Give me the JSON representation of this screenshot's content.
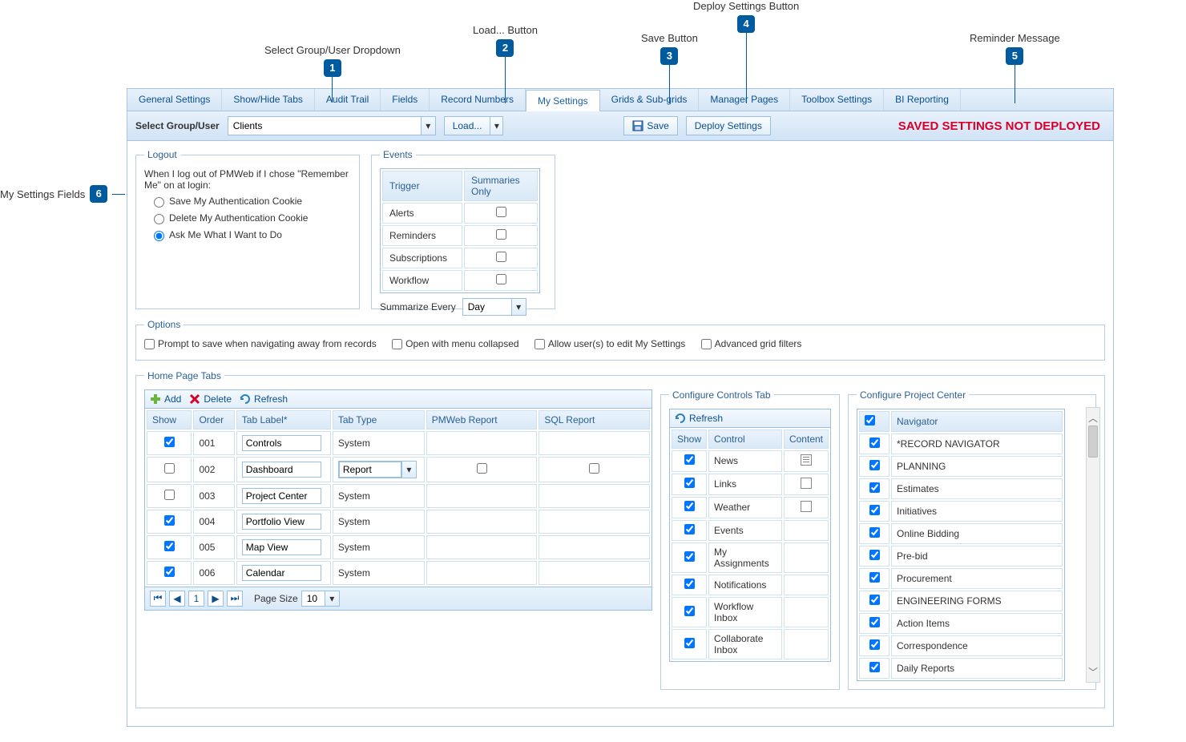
{
  "callouts": {
    "c1": "Select Group/User Dropdown",
    "c2": "Load... Button",
    "c3": "Save Button",
    "c4": "Deploy Settings Button",
    "c5": "Reminder Message",
    "c6": "My Settings Fields"
  },
  "tabs": {
    "t0": "General Settings",
    "t1": "Show/Hide Tabs",
    "t2": "Audit Trail",
    "t3": "Fields",
    "t4": "Record Numbers",
    "t5": "My Settings",
    "t6": "Grids & Sub-grids",
    "t7": "Manager Pages",
    "t8": "Toolbox Settings",
    "t9": "BI Reporting"
  },
  "toolbar": {
    "select_label": "Select Group/User",
    "select_value": "Clients",
    "load_label": "Load...",
    "save_label": "Save",
    "deploy_label": "Deploy Settings",
    "reminder": "SAVED SETTINGS NOT DEPLOYED"
  },
  "logout": {
    "legend": "Logout",
    "intro": "When I log out of PMWeb if I chose \"Remember Me\" on at login:",
    "opt1": "Save My Authentication Cookie",
    "opt2": "Delete My Authentication Cookie",
    "opt3": "Ask Me What I Want to Do"
  },
  "events": {
    "legend": "Events",
    "col_trigger": "Trigger",
    "col_summaries": "Summaries Only",
    "r1": "Alerts",
    "r2": "Reminders",
    "r3": "Subscriptions",
    "r4": "Workflow",
    "summarize_label": "Summarize Every",
    "summarize_value": "Day"
  },
  "options": {
    "legend": "Options",
    "o1": "Prompt to save when navigating away from records",
    "o2": "Open with menu collapsed",
    "o3": "Allow user(s) to edit My Settings",
    "o4": "Advanced grid filters"
  },
  "home": {
    "legend": "Home Page Tabs",
    "add": "Add",
    "delete": "Delete",
    "refresh": "Refresh",
    "cols": {
      "show": "Show",
      "order": "Order",
      "label": "Tab Label*",
      "type": "Tab Type",
      "pmweb": "PMWeb Report",
      "sql": "SQL Report"
    },
    "rows": [
      {
        "show": true,
        "order": "001",
        "label": "Controls",
        "type": "System"
      },
      {
        "show": false,
        "order": "002",
        "label": "Dashboard",
        "type": "Report",
        "type_dd": true,
        "pmweb_cb": true,
        "sql_cb": true
      },
      {
        "show": false,
        "order": "003",
        "label": "Project Center",
        "type": "System"
      },
      {
        "show": true,
        "order": "004",
        "label": "Portfolio View",
        "type": "System"
      },
      {
        "show": true,
        "order": "005",
        "label": "Map View",
        "type": "System"
      },
      {
        "show": true,
        "order": "006",
        "label": "Calendar",
        "type": "System"
      }
    ],
    "pager": {
      "page": "1",
      "pagesize_label": "Page Size",
      "pagesize": "10"
    }
  },
  "controls_tab": {
    "legend": "Configure Controls Tab",
    "refresh": "Refresh",
    "cols": {
      "show": "Show",
      "control": "Control",
      "content": "Content"
    },
    "rows": [
      {
        "label": "News",
        "icon": "list"
      },
      {
        "label": "Links",
        "icon": "box"
      },
      {
        "label": "Weather",
        "icon": "box"
      },
      {
        "label": "Events"
      },
      {
        "label": "My Assignments"
      },
      {
        "label": "Notifications"
      },
      {
        "label": "Workflow Inbox"
      },
      {
        "label": "Collaborate Inbox"
      }
    ]
  },
  "project_center": {
    "legend": "Configure Project Center",
    "col": "Navigator",
    "rows": [
      {
        "label": "*RECORD NAVIGATOR",
        "bold": true
      },
      {
        "label": "PLANNING",
        "bold": true
      },
      {
        "label": "Estimates"
      },
      {
        "label": "Initiatives"
      },
      {
        "label": "Online Bidding"
      },
      {
        "label": "Pre-bid"
      },
      {
        "label": "Procurement"
      },
      {
        "label": "ENGINEERING FORMS",
        "bold": true
      },
      {
        "label": "Action Items"
      },
      {
        "label": "Correspondence"
      },
      {
        "label": "Daily Reports"
      }
    ]
  }
}
